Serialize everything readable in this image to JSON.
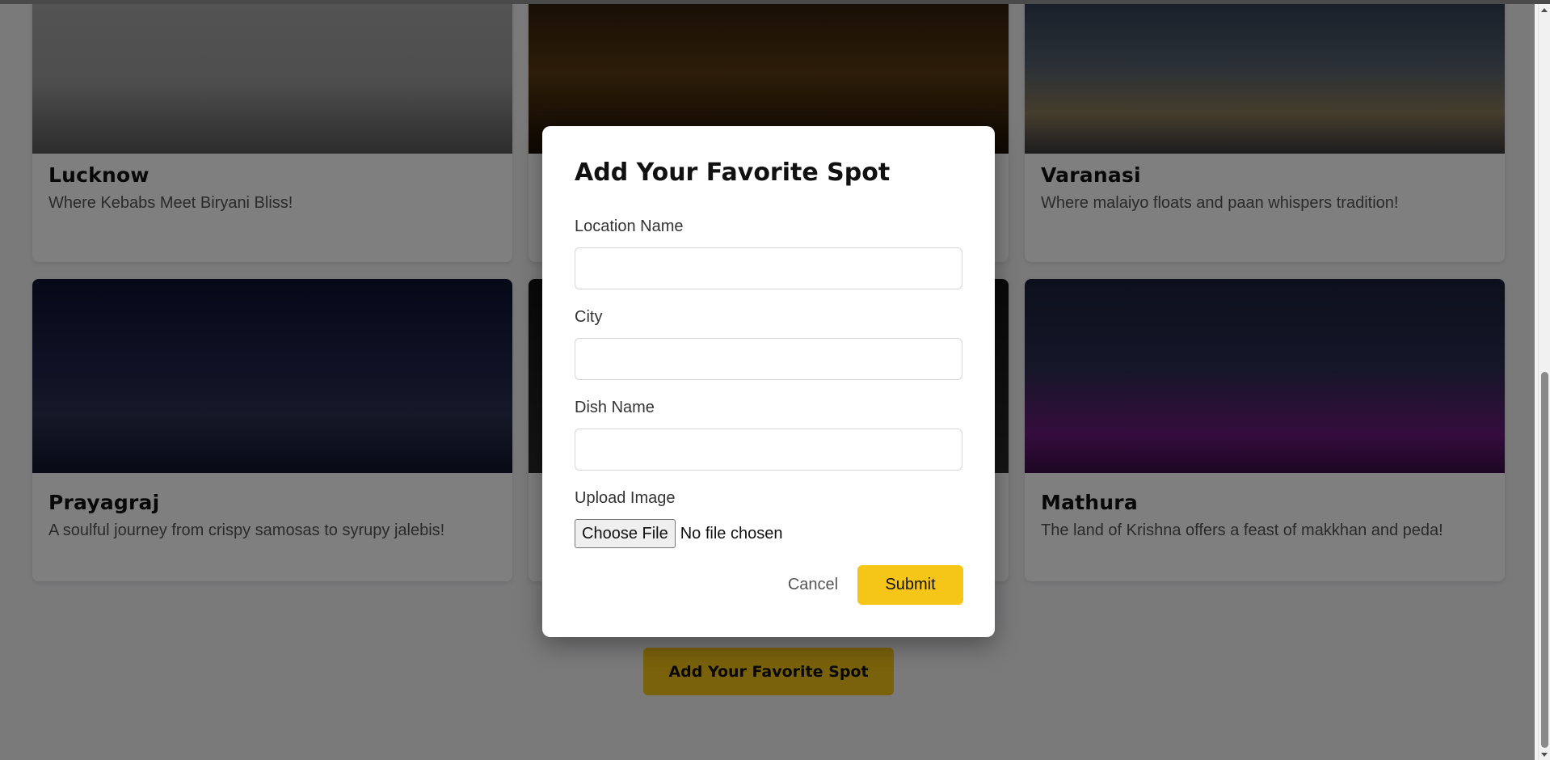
{
  "cards": [
    {
      "title": "Lucknow",
      "description": "Where Kebabs Meet Biryani Bliss!"
    },
    {
      "title": "",
      "description": ""
    },
    {
      "title": "Varanasi",
      "description": "Where malaiyo floats and paan whispers tradition!"
    },
    {
      "title": "Prayagraj",
      "description": "A soulful journey from crispy samosas to syrupy jalebis!"
    },
    {
      "title": "",
      "description": ""
    },
    {
      "title": "Mathura",
      "description": "The land of Krishna offers a feast of makkhan and peda!"
    }
  ],
  "main_button": {
    "label": "Add Your Favorite Spot"
  },
  "modal": {
    "title": "Add Your Favorite Spot",
    "fields": {
      "location": {
        "label": "Location Name",
        "value": ""
      },
      "city": {
        "label": "City",
        "value": ""
      },
      "dish": {
        "label": "Dish Name",
        "value": ""
      },
      "image": {
        "label": "Upload Image",
        "button": "Choose File",
        "status": "No file chosen"
      }
    },
    "cancel_label": "Cancel",
    "submit_label": "Submit"
  },
  "colors": {
    "accent": "#f5c518",
    "overlay": "rgba(0,0,0,0.5)"
  }
}
